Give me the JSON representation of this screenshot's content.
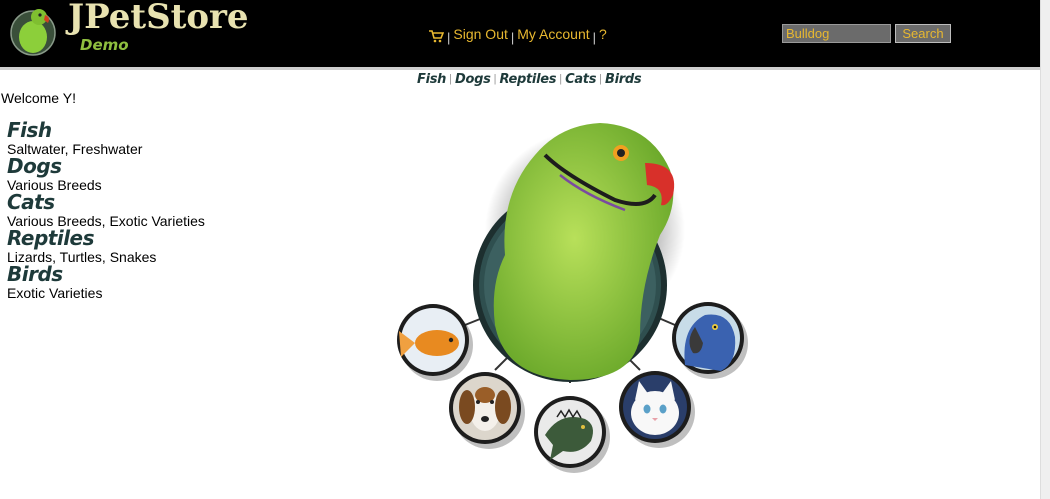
{
  "logo": {
    "title": "JPetStore",
    "subtitle": "Demo",
    "badge": "parrot-logo-icon"
  },
  "menu": {
    "cart_icon": "shopping-cart-icon",
    "sign_out": "Sign Out",
    "my_account": "My Account",
    "help": "?"
  },
  "search": {
    "value": "Bulldog",
    "button": "Search"
  },
  "quicklinks": [
    "Fish",
    "Dogs",
    "Reptiles",
    "Cats",
    "Birds"
  ],
  "welcome": "Welcome Y!",
  "categories": [
    {
      "name": "Fish",
      "description": "Saltwater, Freshwater"
    },
    {
      "name": "Dogs",
      "description": "Various Breeds"
    },
    {
      "name": "Cats",
      "description": "Various Breeds, Exotic Varieties"
    },
    {
      "name": "Reptiles",
      "description": "Lizards, Turtles, Snakes"
    },
    {
      "name": "Birds",
      "description": "Exotic Varieties"
    }
  ],
  "main_image": {
    "center": "parrot-image",
    "thumbnails": [
      "goldfish-image",
      "beagle-image",
      "iguana-image",
      "white-cat-image",
      "blue-macaw-image"
    ]
  },
  "colors": {
    "header_bg": "#000000",
    "menu_link": "#e8b830",
    "category_title": "#1e3a3a",
    "logo_text": "#e8e2b0"
  }
}
